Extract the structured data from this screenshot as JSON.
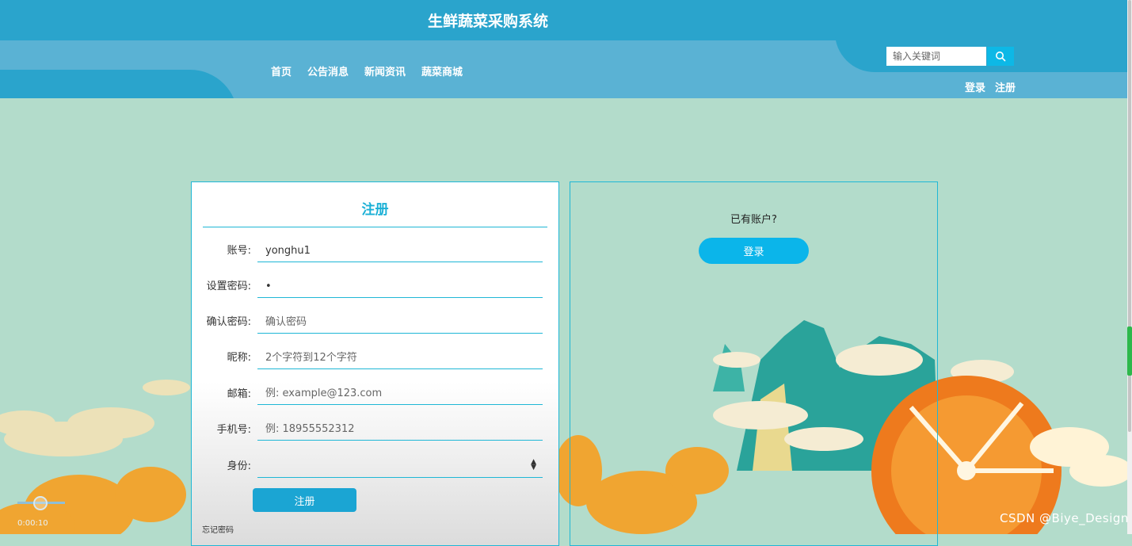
{
  "header": {
    "site_title": "生鲜蔬菜采购系统",
    "nav": [
      "首页",
      "公告消息",
      "新闻资讯",
      "蔬菜商城"
    ],
    "search_placeholder": "输入关键词",
    "login_link": "登录",
    "register_link": "注册"
  },
  "register_form": {
    "title": "注册",
    "fields": [
      {
        "label": "账号:",
        "value": "yonghu1",
        "placeholder": ""
      },
      {
        "label": "设置密码:",
        "value": "•",
        "placeholder": ""
      },
      {
        "label": "确认密码:",
        "value": "",
        "placeholder": "确认密码"
      },
      {
        "label": "昵称:",
        "value": "",
        "placeholder": "2个字符到12个字符"
      },
      {
        "label": "邮箱:",
        "value": "",
        "placeholder": "例: example@123.com"
      },
      {
        "label": "手机号:",
        "value": "",
        "placeholder": "例: 18955552312"
      }
    ],
    "identity_label": "身份:",
    "identity_value": "",
    "submit_label": "注册",
    "forgot_label": "忘记密码"
  },
  "login_panel": {
    "has_account_text": "已有账户?",
    "login_button": "登录"
  },
  "video_overlay": {
    "time": "0:00:10"
  },
  "watermark": "CSDN @Biye_Design",
  "colors": {
    "header_dark": "#2aa4cc",
    "header_light": "#5ab2d4",
    "accent": "#1fb7d6",
    "background": "#b3dccb"
  }
}
